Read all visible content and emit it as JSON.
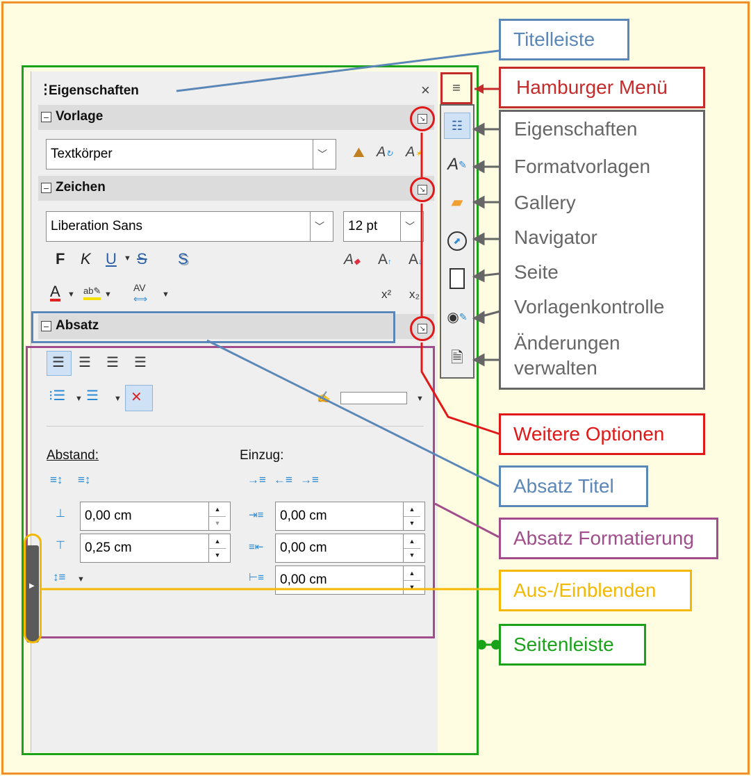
{
  "panel": {
    "title": "Eigenschaften",
    "close_glyph": "×",
    "grip_glyph": "⋮",
    "menu_glyph": "≡"
  },
  "sections": {
    "vorlage": {
      "title": "Vorlage",
      "style_value": "Textkörper"
    },
    "zeichen": {
      "title": "Zeichen",
      "font_value": "Liberation Sans",
      "size_value": "12 pt",
      "bold": "F",
      "italic": "K",
      "underline": "U",
      "strike": "S",
      "shadow": "S",
      "superscript": "x²",
      "subscript": "x₂"
    },
    "absatz": {
      "title": "Absatz",
      "abstand_label": "Abstand:",
      "einzug_label": "Einzug:",
      "above_value": "0,00 cm",
      "below_value": "0,25 cm",
      "indent_before_value": "0,00 cm",
      "indent_after_value": "0,00 cm",
      "first_line_value": "0,00 cm"
    }
  },
  "callouts": {
    "titelleiste": "Titelleiste",
    "hamburger": "Hamburger Menü",
    "eigenschaften": "Eigenschaften",
    "formatvorlagen": "Formatvorlagen",
    "gallery": "Gallery",
    "navigator": "Navigator",
    "seite": "Seite",
    "vorlagenkontrolle": "Vorlagenkontrolle",
    "aenderungen_1": "Änderungen",
    "aenderungen_2": "verwalten",
    "weitere_optionen": "Weitere Optionen",
    "absatz_titel": "Absatz Titel",
    "absatz_formatierung": "Absatz Formatierung",
    "aus_einblenden": "Aus-/Einblenden",
    "seitenleiste": "Seitenleiste"
  },
  "colors": {
    "orange": "#f0902a",
    "green": "#1aa31a",
    "red": "#e01818",
    "dark_red": "#c52b2b",
    "blue": "#5b87b8",
    "purple": "#a14d8b",
    "yellow": "#f5b800",
    "gray": "#666666"
  },
  "icons": {
    "tabbar": [
      "properties-icon",
      "styles-icon",
      "gallery-icon",
      "navigator-icon",
      "page-icon",
      "style-inspector-icon",
      "manage-changes-icon"
    ]
  }
}
